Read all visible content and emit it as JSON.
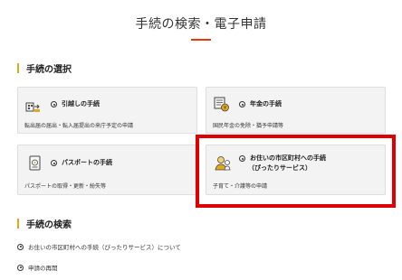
{
  "header": {
    "title": "手続の検索・電子申請"
  },
  "selection": {
    "heading": "手続の選択",
    "cards": [
      {
        "title": "引越しの手続",
        "desc": "転出届の届出・転入届提出の来庁予定の申請",
        "icon": "moving-house-icon"
      },
      {
        "title": "年金の手続",
        "desc": "国民年金の免除・猶予申請等",
        "icon": "pension-icon"
      },
      {
        "title": "パスポートの手続",
        "desc": "パスポートの取得・更新・紛失等",
        "icon": "passport-icon"
      },
      {
        "title_line1": "お住いの市区町村への手続",
        "title_line2": "（ぴったりサービス）",
        "desc": "子育て・介護等の申請",
        "icon": "family-icon"
      }
    ]
  },
  "search": {
    "heading": "手続の検索",
    "links": [
      {
        "label": "お住いの市区町村への手続（ぴったりサービス）について"
      },
      {
        "label": "申請の再開"
      }
    ]
  },
  "colors": {
    "accent_red": "#e8390e",
    "highlight_red": "#e00000",
    "heading_bar": "#e6a817"
  }
}
